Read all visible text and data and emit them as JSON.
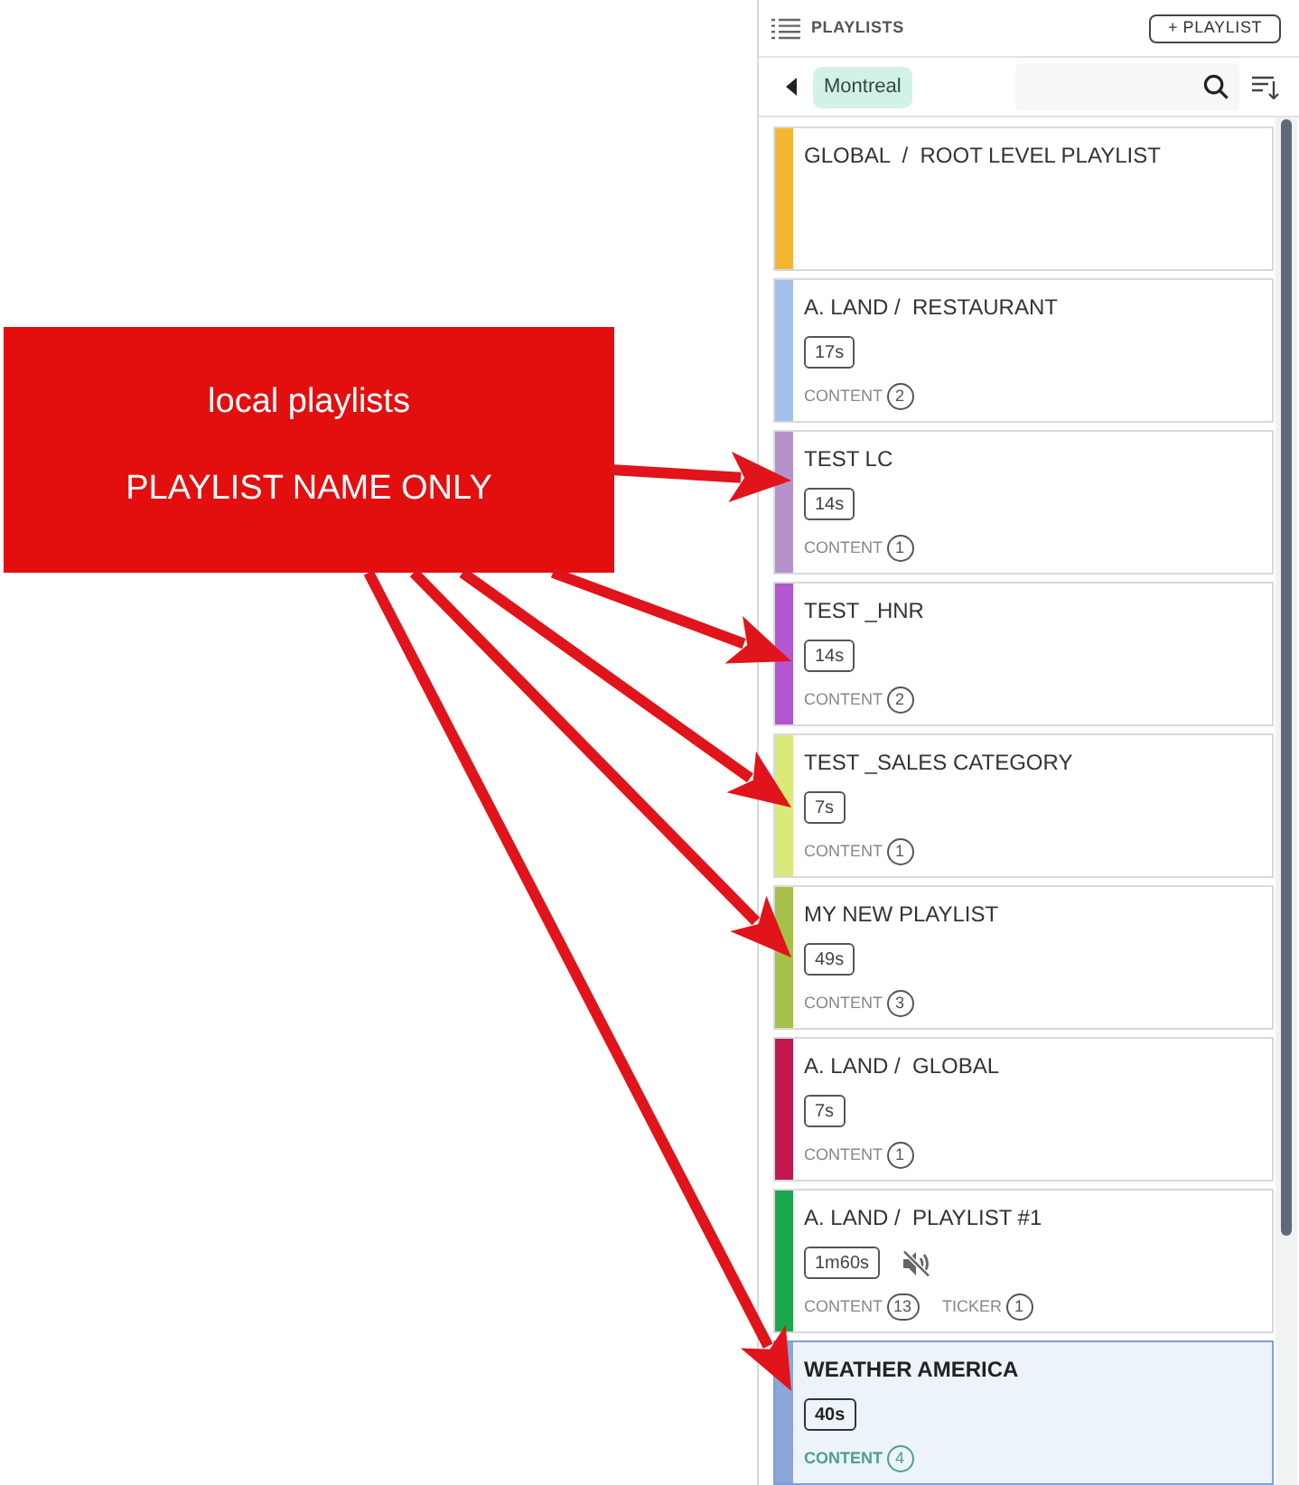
{
  "annotation": {
    "lines": [
      "local playlists",
      "PLAYLIST NAME ONLY"
    ]
  },
  "panel": {
    "title": "PLAYLISTS",
    "add_button": "+ PLAYLIST",
    "location_chip": "Montreal"
  },
  "playlists": [
    {
      "name": "GLOBAL  /  ROOT LEVEL PLAYLIST",
      "color": "#f5b733",
      "muted": false,
      "selected": false
    },
    {
      "name": "A. LAND /  RESTAURANT",
      "color": "#a3bfe9",
      "duration": "17s",
      "muted": false,
      "counts": [
        {
          "label": "CONTENT",
          "value": "2"
        }
      ],
      "selected": false
    },
    {
      "name": "TEST LC",
      "color": "#b592c9",
      "duration": "14s",
      "muted": false,
      "counts": [
        {
          "label": "CONTENT",
          "value": "1"
        }
      ],
      "selected": false
    },
    {
      "name": "TEST _HNR",
      "color": "#b356cf",
      "duration": "14s",
      "muted": false,
      "counts": [
        {
          "label": "CONTENT",
          "value": "2"
        }
      ],
      "selected": false
    },
    {
      "name": "TEST _SALES CATEGORY",
      "color": "#dbe979",
      "duration": "7s",
      "muted": false,
      "counts": [
        {
          "label": "CONTENT",
          "value": "1"
        }
      ],
      "selected": false
    },
    {
      "name": "MY NEW PLAYLIST",
      "color": "#a7c04a",
      "duration": "49s",
      "muted": false,
      "counts": [
        {
          "label": "CONTENT",
          "value": "3"
        }
      ],
      "selected": false
    },
    {
      "name": "A. LAND /  GLOBAL",
      "color": "#c3184f",
      "duration": "7s",
      "muted": false,
      "counts": [
        {
          "label": "CONTENT",
          "value": "1"
        }
      ],
      "selected": false
    },
    {
      "name": "A. LAND /  PLAYLIST #1",
      "color": "#1ba84c",
      "duration": "1m60s",
      "muted": true,
      "counts": [
        {
          "label": "CONTENT",
          "value": "13"
        },
        {
          "label": "TICKER",
          "value": "1"
        }
      ],
      "selected": false
    },
    {
      "name": "WEATHER AMERICA",
      "color": "#8ca6d9",
      "duration": "40s",
      "muted": false,
      "counts": [
        {
          "label": "CONTENT",
          "value": "4"
        }
      ],
      "selected": true
    }
  ]
}
